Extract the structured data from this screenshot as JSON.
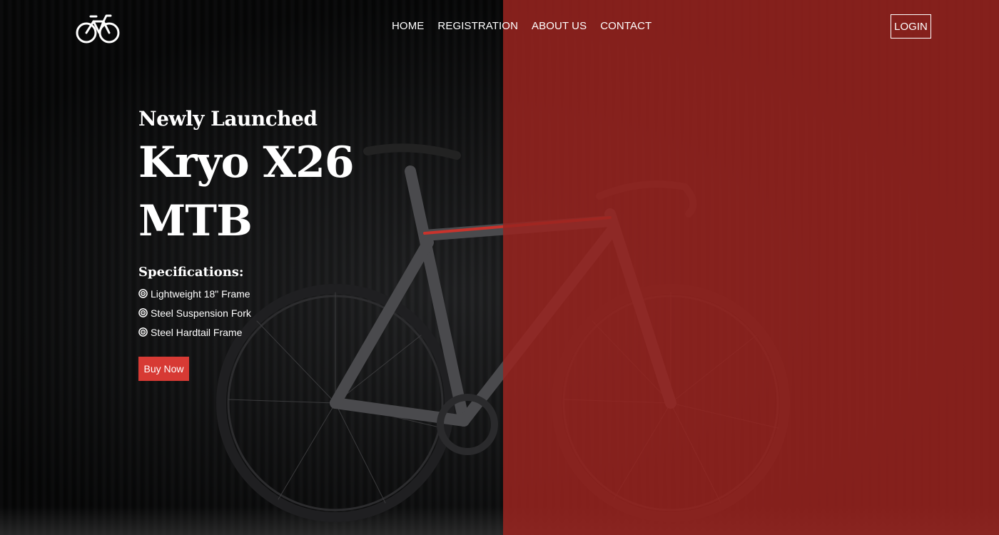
{
  "header": {
    "logo_icon": "bicycle-icon",
    "nav": [
      "HOME",
      "REGISTRATION",
      "ABOUT US",
      "CONTACT"
    ],
    "login_label": "LOGIN"
  },
  "hero": {
    "subtitle": "Newly Launched",
    "title_line1": "Kryo X26",
    "title_line2": "MTB",
    "specs_heading": "Specifications:",
    "spec_icon": "target-icon",
    "specs": [
      "Lightweight 18\" Frame",
      "Steel Suspension Fork",
      "Steel Hardtail Frame"
    ],
    "buy_label": "Buy Now",
    "accent_color": "#d73a34",
    "overlay_color": "#9a2420"
  }
}
